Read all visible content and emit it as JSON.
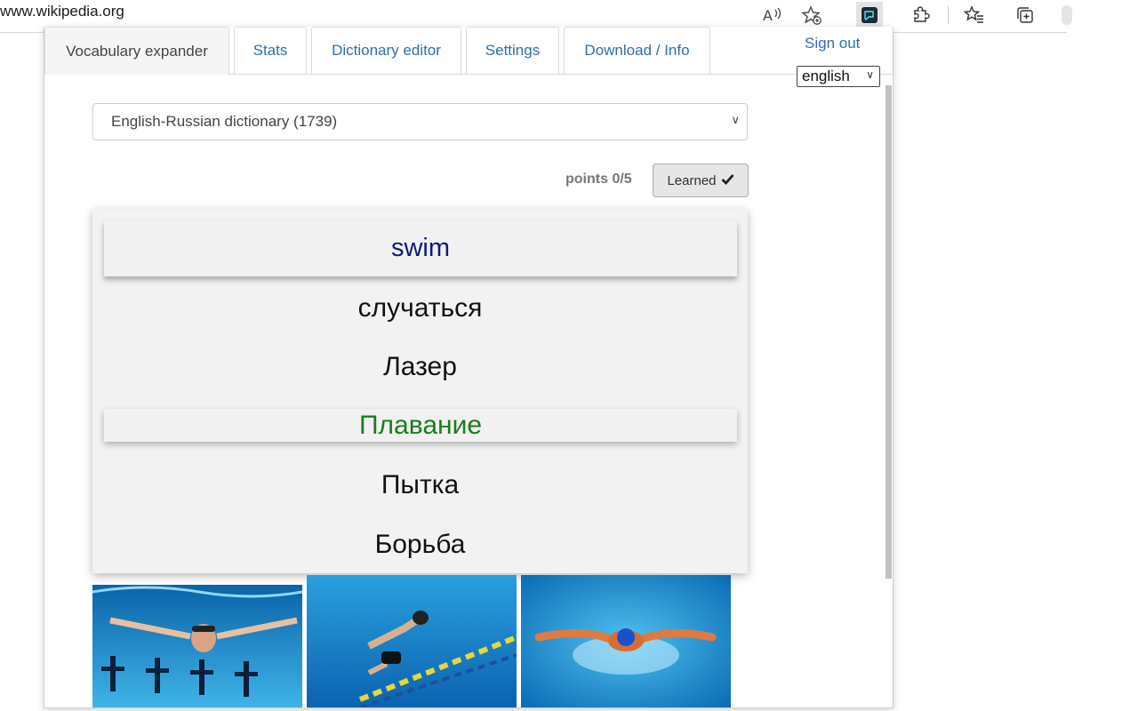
{
  "browser": {
    "url": "www.wikipedia.org",
    "icons": [
      "read-aloud-icon",
      "favorite-add-icon",
      "extension-active-icon",
      "extensions-icon",
      "favorites-icon",
      "collections-icon"
    ]
  },
  "tabs": [
    {
      "label": "Vocabulary expander",
      "active": true
    },
    {
      "label": "Stats",
      "active": false
    },
    {
      "label": "Dictionary editor",
      "active": false
    },
    {
      "label": "Settings",
      "active": false
    },
    {
      "label": "Download / Info",
      "active": false
    }
  ],
  "header": {
    "sign_out": "Sign out",
    "language": "english"
  },
  "dictionary": {
    "selected": "English-Russian dictionary (1739)"
  },
  "progress": {
    "points": "points 0/5",
    "learned_label": "Learned"
  },
  "quiz": {
    "word": "swim",
    "options": [
      "случаться",
      "Лазер",
      "Плавание",
      "Пытка",
      "Борьба"
    ],
    "correct_index": 2
  },
  "colors": {
    "link": "#2f6fab",
    "word": "#0c1a7a",
    "correct": "#1a7f1a"
  }
}
